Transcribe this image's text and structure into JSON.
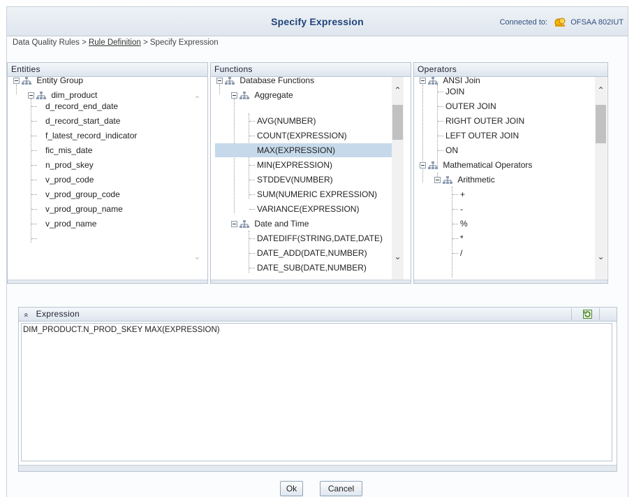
{
  "header": {
    "title": "Specify Expression",
    "connected_label": "Connected to:",
    "connected_server": "OFSAA 802IUT"
  },
  "breadcrumb": {
    "part1": "Data Quality Rules",
    "sep1": " > ",
    "part2": "Rule Definition",
    "sep2": " > ",
    "part3": "Specify Expression"
  },
  "entities": {
    "title": "Entities",
    "root": "Entity Group",
    "group": "dim_product",
    "items": [
      "d_record_end_date",
      "d_record_start_date",
      "f_latest_record_indicator",
      "fic_mis_date",
      "n_prod_skey",
      "v_prod_code",
      "v_prod_group_code",
      "v_prod_group_name",
      "v_prod_name"
    ]
  },
  "functions": {
    "title": "Functions",
    "root": "Database Functions",
    "aggregate": {
      "label": "Aggregate",
      "items": [
        "AVG(NUMBER)",
        "COUNT(EXPRESSION)",
        "MAX(EXPRESSION)",
        "MIN(EXPRESSION)",
        "STDDEV(NUMBER)",
        "SUM(NUMERIC EXPRESSION)",
        "VARIANCE(EXPRESSION)"
      ]
    },
    "datetime": {
      "label": "Date and Time",
      "items": [
        "DATEDIFF(STRING,DATE,DATE)",
        "DATE_ADD(DATE,NUMBER)",
        "DATE_SUB(DATE,NUMBER)"
      ]
    },
    "selected": "MAX(EXPRESSION)"
  },
  "operators": {
    "title": "Operators",
    "ansi": {
      "label": "ANSI Join",
      "items": [
        "JOIN",
        "OUTER JOIN",
        "RIGHT OUTER JOIN",
        "LEFT OUTER JOIN",
        "ON"
      ]
    },
    "math": {
      "label": "Mathematical Operators",
      "arith_label": "Arithmetic",
      "items": [
        "+",
        "-",
        "%",
        "*",
        "/"
      ]
    }
  },
  "expression": {
    "title": "Expression",
    "collapse_glyph": "»",
    "value": "DIM_PRODUCT.N_PROD_SKEY MAX(EXPRESSION)"
  },
  "buttons": {
    "ok": "Ok",
    "cancel": "Cancel"
  }
}
